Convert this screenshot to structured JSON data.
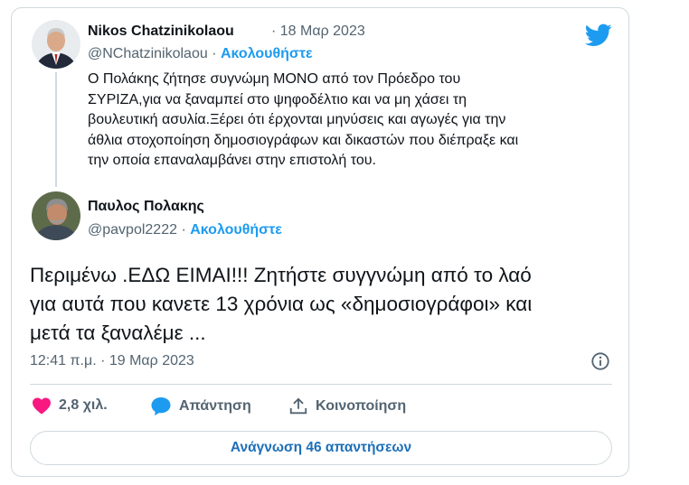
{
  "quoted": {
    "name": "Nikos Chatzinikolaou",
    "date": "· 18 Μαρ 2023",
    "handle": "@NChatzinikolaou",
    "separator": "·",
    "follow": "Ακολουθήστε",
    "lines": [
      "Ο Πολάκης ζήτησε συγνώμη ΜΟΝΟ από τον Πρόεδρο του",
      "ΣΥΡΙΖΑ,για να ξαναμπεί στο ψηφοδέλτιο και να μη χάσει τη",
      "βουλευτική ασυλία.Ξέρει ότι έρχονται μηνύσεις και αγωγές για την",
      "άθλια στοχοποίηση δημοσιογράφων και δικαστών που διέπραξε και",
      "την οποία επαναλαμβάνει στην επιστολή του."
    ]
  },
  "reply": {
    "name": "Παυλος Πολακης",
    "handle": "@pavpol2222",
    "separator": "·",
    "follow": "Ακολουθήστε",
    "lines": [
      "Περιμένω .ΕΔΩ ΕΙΜΑΙ!!! Ζητήστε συγγνώμη από το λαό",
      "για αυτά που κανετε 13 χρόνια ως «δημοσιογράφοι» και",
      "μετά τα ξαναλέμε ..."
    ],
    "timestamp": "12:41 π.μ. · 19 Μαρ 2023"
  },
  "actions": {
    "likes": "2,8 χιλ.",
    "reply_label": "Απάντηση",
    "share_label": "Κοινοποίηση"
  },
  "read_replies": "Ανάγνωση 46 απαντήσεων",
  "icons": [
    "twitter-bird-icon",
    "info-icon",
    "heart-icon",
    "reply-bubble-icon",
    "share-icon"
  ],
  "colors": {
    "accent": "#1d9bf0",
    "heart": "#f91880",
    "muted": "#536471",
    "border": "#cfd9de"
  }
}
